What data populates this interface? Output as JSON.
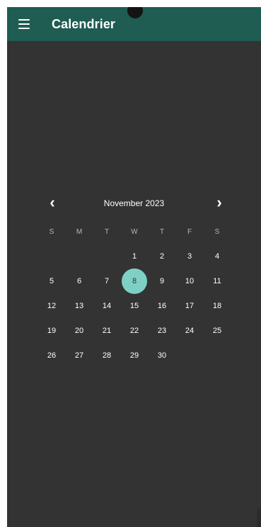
{
  "app": {
    "title": "Calendrier"
  },
  "calendar": {
    "month_label": "November 2023",
    "prev_icon": "chevron-left-icon",
    "next_icon": "chevron-right-icon",
    "weekdays": [
      "S",
      "M",
      "T",
      "W",
      "T",
      "F",
      "S"
    ],
    "weeks": [
      [
        "",
        "",
        "",
        "1",
        "2",
        "3",
        "4"
      ],
      [
        "5",
        "6",
        "7",
        "8",
        "9",
        "10",
        "11"
      ],
      [
        "12",
        "13",
        "14",
        "15",
        "16",
        "17",
        "18"
      ],
      [
        "19",
        "20",
        "21",
        "22",
        "23",
        "24",
        "25"
      ],
      [
        "26",
        "27",
        "28",
        "29",
        "30",
        "",
        ""
      ]
    ],
    "selected_day": "8",
    "selected_color": "#7fd0c4"
  },
  "colors": {
    "appbar": "#1f5c52",
    "background": "#333333"
  }
}
